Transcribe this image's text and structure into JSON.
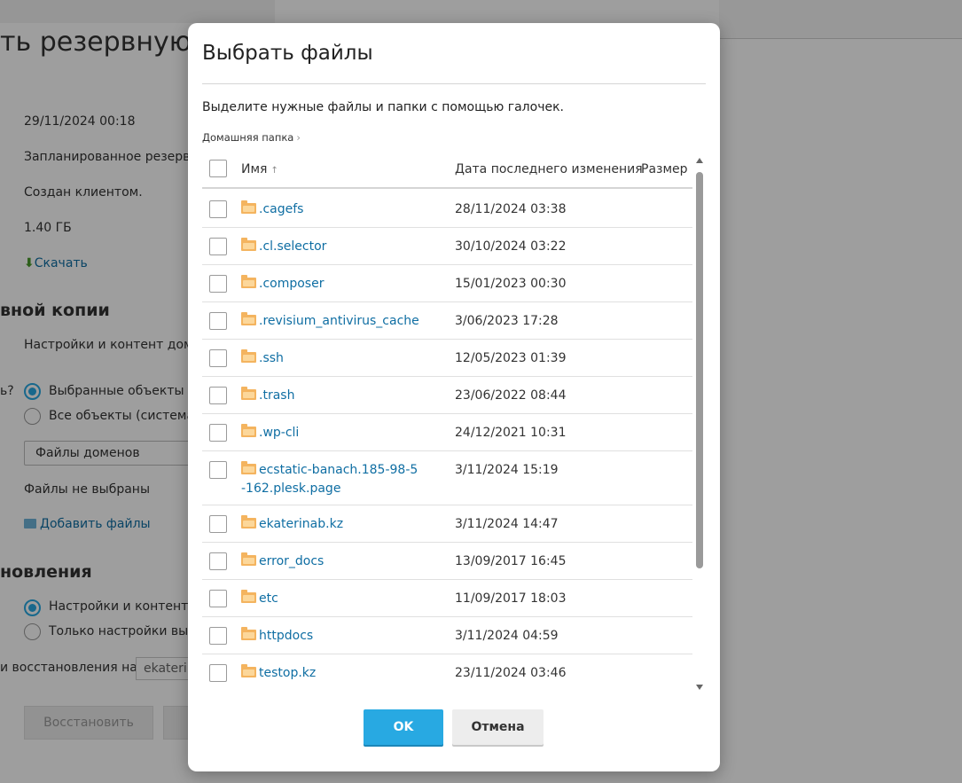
{
  "background": {
    "title": "ть резервную",
    "date": "29/11/2024 00:18",
    "type": "Запланированное резервн",
    "created_by": "Создан клиентом.",
    "size": "1.40 ГБ",
    "download_link": "Скачать",
    "section_backup": "вной копии",
    "backup_contents": "Настройки и контент домен",
    "question": "ь?",
    "radio_selected": "Выбранные объекты",
    "radio_all": "Все объекты (система и",
    "select_value": "Файлы доменов",
    "files_not_selected": "Файлы не выбраны",
    "add_files_link": "Добавить файлы",
    "section_restore": "новления",
    "restore_settings_content": "Настройки и контент в",
    "restore_settings_only": "Только настройки выбр",
    "restore_to_label": "и восстановления на",
    "restore_to_value": "ekaterin",
    "restore_button": "Восстановить"
  },
  "dialog": {
    "title": "Выбрать файлы",
    "hint": "Выделите нужные файлы и папки с помощью галочек.",
    "breadcrumb": "Домашняя папка",
    "columns": {
      "name": "Имя",
      "modified": "Дата последнего изменения",
      "size": "Размер"
    },
    "rows": [
      {
        "name": ".cagefs",
        "date": "28/11/2024 03:38"
      },
      {
        "name": ".cl.selector",
        "date": "30/10/2024 03:22"
      },
      {
        "name": ".composer",
        "date": "15/01/2023 00:30"
      },
      {
        "name": ".revisium_antivirus_cache",
        "date": "3/06/2023 17:28"
      },
      {
        "name": ".ssh",
        "date": "12/05/2023 01:39"
      },
      {
        "name": ".trash",
        "date": "23/06/2022 08:44"
      },
      {
        "name": ".wp-cli",
        "date": "24/12/2021 10:31"
      },
      {
        "name": "ecstatic-banach.185-98-5-162.plesk.page",
        "date": "3/11/2024 15:19"
      },
      {
        "name": "ekaterinab.kz",
        "date": "3/11/2024 14:47"
      },
      {
        "name": "error_docs",
        "date": "13/09/2017 16:45"
      },
      {
        "name": "etc",
        "date": "11/09/2017 18:03"
      },
      {
        "name": "httpdocs",
        "date": "3/11/2024 04:59"
      },
      {
        "name": "testop.kz",
        "date": "23/11/2024 03:46"
      }
    ],
    "ok_label": "OK",
    "cancel_label": "Отмена"
  },
  "colors": {
    "accent": "#28a9e2",
    "link": "#0f6ea3",
    "folder": "#f4b45f"
  }
}
